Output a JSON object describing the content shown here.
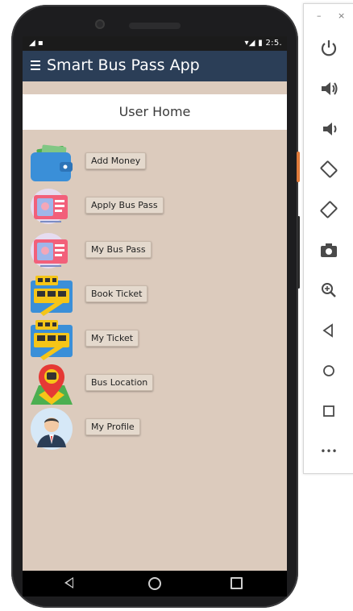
{
  "status": {
    "left": "◢ ▪",
    "right": "▾◢ ▮ 2:5."
  },
  "app": {
    "title": "Smart Bus Pass App"
  },
  "page": {
    "title": "User Home"
  },
  "menu": [
    {
      "label": "Add Money",
      "icon": "wallet-icon"
    },
    {
      "label": "Apply Bus Pass",
      "icon": "ticket-icon"
    },
    {
      "label": "My Bus Pass",
      "icon": "ticket-icon"
    },
    {
      "label": "Book Ticket",
      "icon": "bus-ticket-icon"
    },
    {
      "label": "My Ticket",
      "icon": "bus-ticket-icon"
    },
    {
      "label": "Bus Location",
      "icon": "map-pin-icon"
    },
    {
      "label": "My Profile",
      "icon": "user-avatar-icon"
    }
  ],
  "emulator": {
    "minimize": "–",
    "close": "×",
    "more": "•••",
    "buttons": [
      "power-icon",
      "volume-up-icon",
      "volume-down-icon",
      "rotate-left-icon",
      "rotate-right-icon",
      "camera-icon",
      "zoom-icon",
      "back-icon",
      "home-icon",
      "overview-icon",
      "more-icon"
    ]
  },
  "colors": {
    "appbar": "#2b3e57",
    "background": "#dccbbd",
    "button": "#e4d9cd"
  }
}
